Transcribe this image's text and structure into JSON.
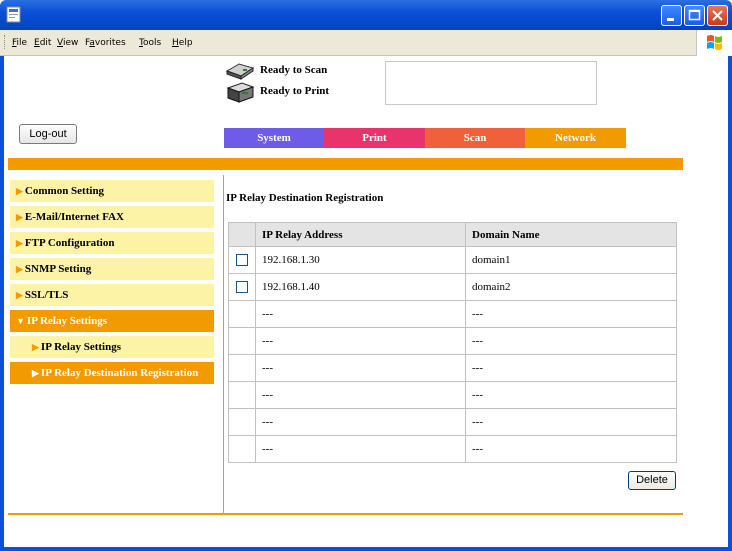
{
  "window": {
    "menu": [
      {
        "pre": "",
        "u": "F",
        "post": "ile"
      },
      {
        "pre": "",
        "u": "E",
        "post": "dit"
      },
      {
        "pre": "",
        "u": "V",
        "post": "iew"
      },
      {
        "pre": "F",
        "u": "a",
        "post": "vorites"
      },
      {
        "pre": "",
        "u": "T",
        "post": "ools"
      },
      {
        "pre": "",
        "u": "H",
        "post": "elp"
      }
    ]
  },
  "status": {
    "scan": "Ready to Scan",
    "print": "Ready to Print"
  },
  "logout_label": "Log-out",
  "tabs": [
    {
      "label": "System",
      "color": "#6c5ce7"
    },
    {
      "label": "Print",
      "color": "#e8336d"
    },
    {
      "label": "Scan",
      "color": "#f0603a"
    },
    {
      "label": "Network",
      "color": "#f29b00"
    }
  ],
  "sidebar": [
    {
      "label": "Common Setting",
      "marker": "▶"
    },
    {
      "label": "E-Mail/Internet FAX",
      "marker": "▶"
    },
    {
      "label": "FTP Configuration",
      "marker": "▶"
    },
    {
      "label": "SNMP Setting",
      "marker": "▶"
    },
    {
      "label": "SSL/TLS",
      "marker": "▶"
    },
    {
      "label": "IP Relay Settings",
      "marker": "▼"
    },
    {
      "label": "IP Relay Settings",
      "marker": "▶"
    },
    {
      "label": "IP Relay Destination Registration",
      "marker": "▶"
    }
  ],
  "main": {
    "title": "IP Relay Destination Registration",
    "columns": [
      "IP Relay Address",
      "Domain Name"
    ],
    "rows": [
      {
        "address": "192.168.1.30",
        "domain": "domain1",
        "checkbox": true
      },
      {
        "address": "192.168.1.40",
        "domain": "domain2",
        "checkbox": true
      },
      {
        "address": "---",
        "domain": "---",
        "checkbox": false
      },
      {
        "address": "---",
        "domain": "---",
        "checkbox": false
      },
      {
        "address": "---",
        "domain": "---",
        "checkbox": false
      },
      {
        "address": "---",
        "domain": "---",
        "checkbox": false
      },
      {
        "address": "---",
        "domain": "---",
        "checkbox": false
      },
      {
        "address": "---",
        "domain": "---",
        "checkbox": false
      }
    ],
    "delete_label": "Delete"
  },
  "colors": {
    "accent": "#f29b00",
    "sidebar_bg": "#fdf3a7",
    "titlebar": "#0a50d8"
  },
  "icons": [
    "app-window-icon",
    "minimize-icon",
    "maximize-icon",
    "close-icon",
    "windows-logo-icon",
    "scanner-icon",
    "printer-icon"
  ]
}
